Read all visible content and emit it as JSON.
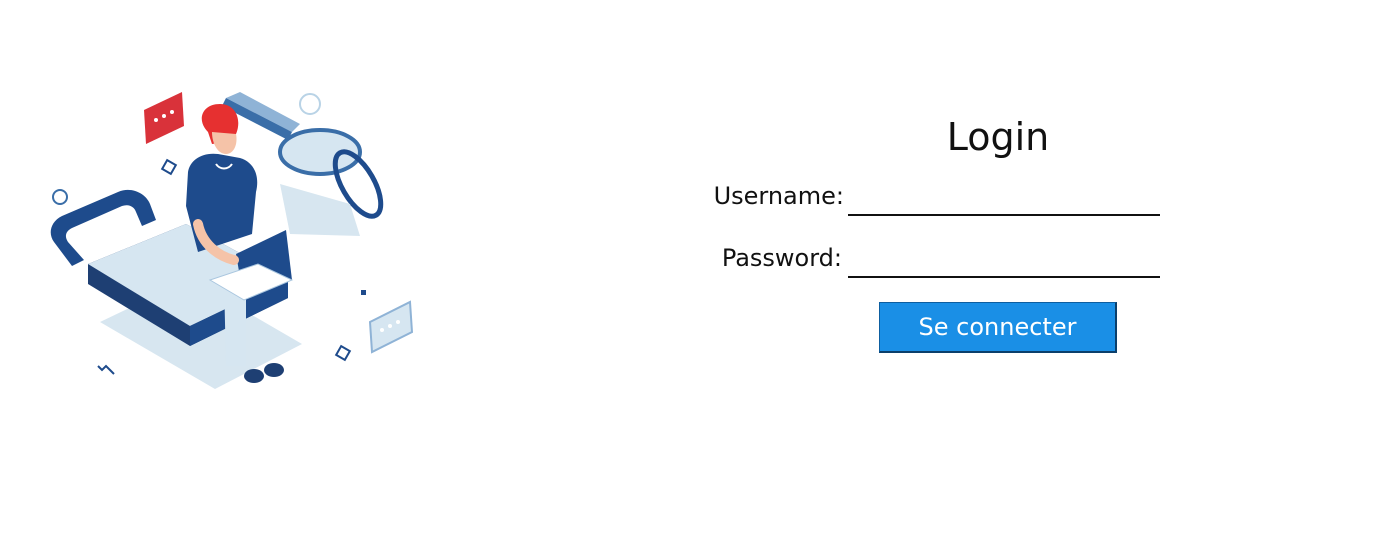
{
  "login": {
    "title": "Login",
    "username_label": "Username:",
    "username_value": "",
    "password_label": "Password:",
    "password_value": "",
    "submit_label": "Se connecter"
  },
  "colors": {
    "accent": "#1a8fe6",
    "illustration_dark_blue": "#1e4b8c",
    "illustration_light_blue": "#cfe3f0",
    "illustration_red": "#e02020"
  },
  "icons": {
    "illustration": "padlock-with-key-and-user-on-laptop"
  }
}
